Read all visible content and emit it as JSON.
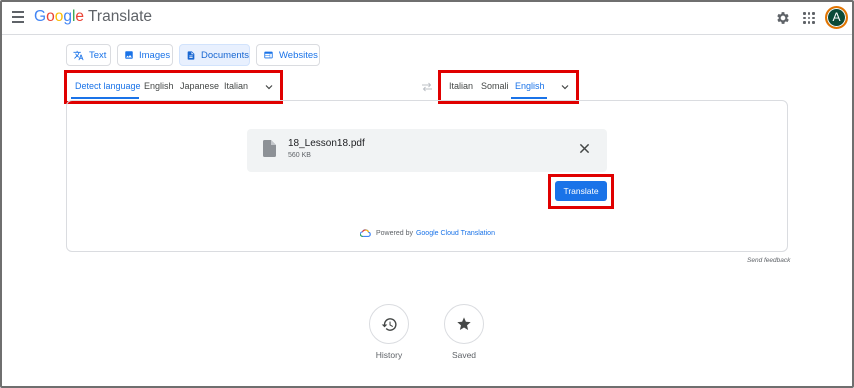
{
  "app": {
    "logo_google": [
      "G",
      "o",
      "o",
      "g",
      "l",
      "e"
    ],
    "logo_suffix": "Translate",
    "avatar_letter": "A",
    "icons": [
      "menu-icon",
      "gear-icon",
      "apps-grid-icon"
    ]
  },
  "modes": [
    {
      "label": "Text",
      "icon": "translate-icon",
      "active": false
    },
    {
      "label": "Images",
      "icon": "image-icon",
      "active": false
    },
    {
      "label": "Documents",
      "icon": "document-icon",
      "active": true
    },
    {
      "label": "Websites",
      "icon": "website-icon",
      "active": false
    }
  ],
  "source_languages": {
    "items": [
      "Detect language",
      "English",
      "Japanese",
      "Italian"
    ],
    "selected": "Detect language"
  },
  "target_languages": {
    "items": [
      "Italian",
      "Somali",
      "English"
    ],
    "selected": "English"
  },
  "file": {
    "name": "18_Lesson18.pdf",
    "size": "560 KB"
  },
  "translate_button": "Translate",
  "powered": {
    "prefix": "Powered by",
    "link": "Google Cloud Translation"
  },
  "feedback": "Send feedback",
  "bottom": {
    "history": "History",
    "saved": "Saved"
  },
  "colors": {
    "accent": "#1a73e8",
    "highlight_box": "#e00000",
    "active_tab_bg": "#e8f0fe"
  }
}
